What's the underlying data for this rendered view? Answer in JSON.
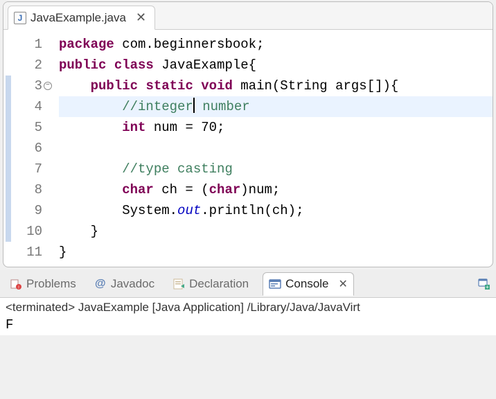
{
  "editor": {
    "tab": {
      "icon_letter": "J",
      "filename": "JavaExample.java",
      "close_glyph": "✕"
    },
    "gutter_numbers": [
      "1",
      "2",
      "3",
      "4",
      "5",
      "6",
      "7",
      "8",
      "9",
      "10",
      "11"
    ],
    "fold_glyph": "−",
    "code_tokens": {
      "l1": {
        "package": "package",
        "pkg": " com.beginnersbook;"
      },
      "l2": {
        "public": "public",
        "class": "class",
        "name": " JavaExample{"
      },
      "l3": {
        "public": "public",
        "static": "static",
        "void": "void",
        "sig": " main(String args[]){"
      },
      "l4": {
        "c1": "//integer",
        "c2": " number"
      },
      "l5": {
        "int": "int",
        "rest": " num = 70;"
      },
      "l6": {
        "blank": ""
      },
      "l7": {
        "comment": "//type casting"
      },
      "l8": {
        "char": "char",
        "a": " ch = (",
        "char2": "char",
        "b": ")num;"
      },
      "l9": {
        "a": "System.",
        "out": "out",
        "b": ".println(ch);"
      },
      "l10": {
        "brace": "}"
      },
      "l11": {
        "brace": "}"
      }
    }
  },
  "views": {
    "problems": {
      "label": "Problems"
    },
    "javadoc": {
      "label": "Javadoc",
      "at": "@"
    },
    "declaration": {
      "label": "Declaration"
    },
    "console": {
      "label": "Console",
      "close_glyph": "✕"
    }
  },
  "console": {
    "status": "<terminated> JavaExample [Java Application] /Library/Java/JavaVirt",
    "output": "F"
  }
}
